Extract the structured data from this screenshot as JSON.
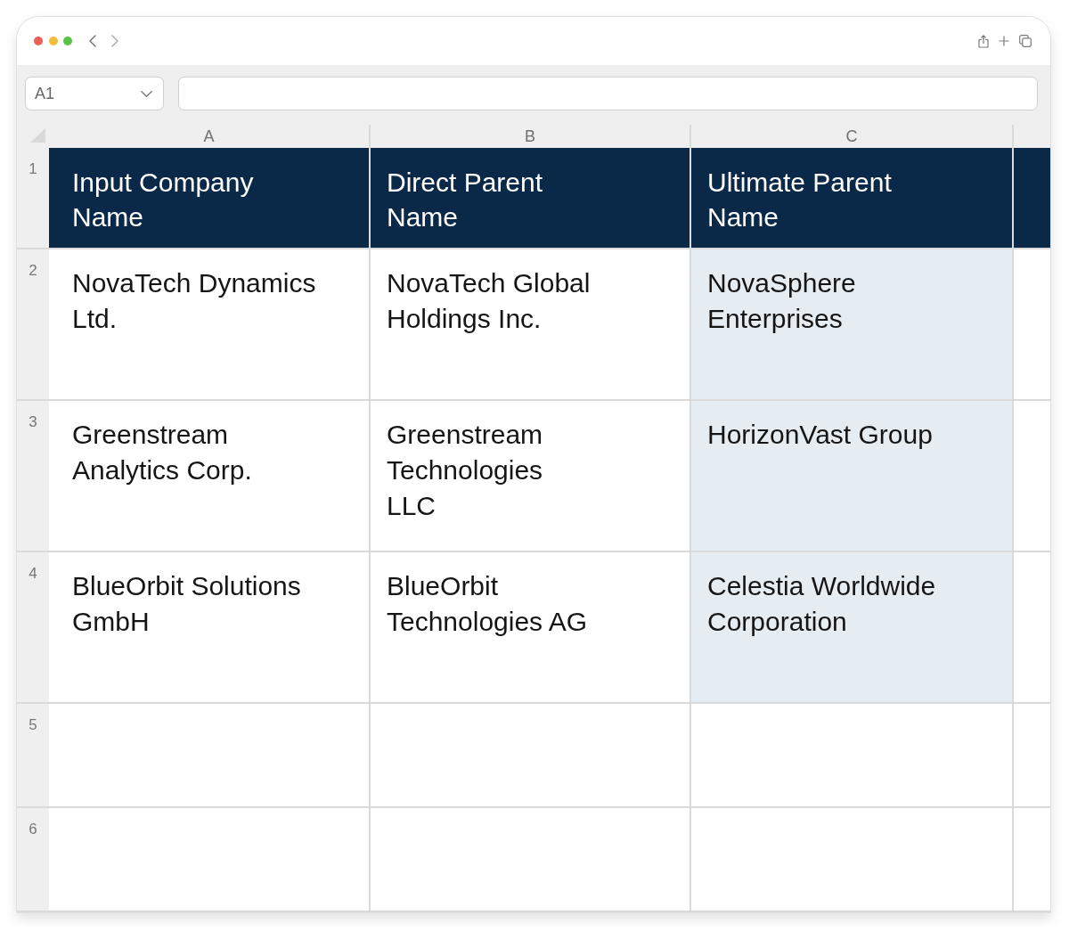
{
  "window": {
    "navigation": [
      {
        "kind": "back",
        "disabled": false
      },
      {
        "kind": "forward",
        "disabled": true
      }
    ]
  },
  "name_box": {
    "value": "A1"
  },
  "column_headers": [
    "A",
    "B",
    "C"
  ],
  "rows": [
    {
      "number": "1",
      "kind": "header",
      "cells": [
        {
          "text": "Input Company\nName",
          "highlighted": false
        },
        {
          "text": "Direct Parent\nName",
          "highlighted": false
        },
        {
          "text": "Ultimate Parent\nName",
          "highlighted": false
        }
      ]
    },
    {
      "number": "2",
      "kind": "data",
      "cells": [
        {
          "text": "NovaTech Dynamics\nLtd.",
          "highlighted": false
        },
        {
          "text": "NovaTech Global\nHoldings Inc.",
          "highlighted": false
        },
        {
          "text": "NovaSphere\nEnterprises",
          "highlighted": true
        }
      ]
    },
    {
      "number": "3",
      "kind": "data",
      "cells": [
        {
          "text": "Greenstream\nAnalytics Corp.",
          "highlighted": false
        },
        {
          "text": "Greenstream\nTechnologies\nLLC",
          "highlighted": false
        },
        {
          "text": "HorizonVast Group",
          "highlighted": true
        }
      ]
    },
    {
      "number": "4",
      "kind": "data",
      "cells": [
        {
          "text": "BlueOrbit Solutions\nGmbH",
          "highlighted": false
        },
        {
          "text": "BlueOrbit\nTechnologies AG",
          "highlighted": false
        },
        {
          "text": "Celestia Worldwide\nCorporation",
          "highlighted": true
        }
      ]
    },
    {
      "number": "5",
      "kind": "data"
    },
    {
      "number": "6",
      "kind": "data"
    }
  ]
}
